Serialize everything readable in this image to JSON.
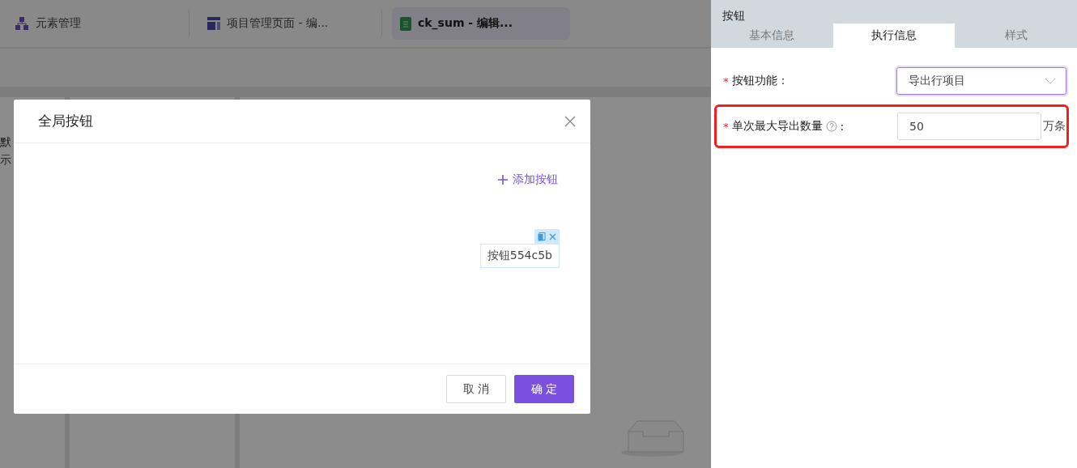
{
  "tabs": [
    {
      "label": "元素管理",
      "kind": "hierarchy",
      "selected": false
    },
    {
      "label": "项目管理页面 - 编...",
      "kind": "layout",
      "selected": false
    },
    {
      "label": "ck_sum - 编辑...",
      "kind": "sheet",
      "selected": true
    }
  ],
  "left_panel": {
    "lines": [
      "默",
      "示"
    ]
  },
  "modal": {
    "title": "全局按钮",
    "add_label": "添加按钮",
    "buttons": [
      {
        "label": "按钮554c5b"
      }
    ],
    "footer": [
      {
        "label": "取 消",
        "kind": "default"
      },
      {
        "label": "确 定",
        "kind": "primary"
      }
    ]
  },
  "panel": {
    "title": "按钮",
    "tabs": [
      {
        "label": "基本信息",
        "selected": false
      },
      {
        "label": "执行信息",
        "selected": true
      },
      {
        "label": "样式",
        "selected": false
      }
    ],
    "fields": [
      {
        "kind": "select",
        "required_mark": "*",
        "label": "按钮功能：",
        "value": "导出行项目",
        "focused": true,
        "highlighted": false
      },
      {
        "kind": "number",
        "required_mark": "*",
        "label": "单次最大导出数量",
        "help": true,
        "label_end": ":",
        "value": "50",
        "suffix": "万条",
        "focused": false,
        "highlighted": true
      }
    ]
  }
}
